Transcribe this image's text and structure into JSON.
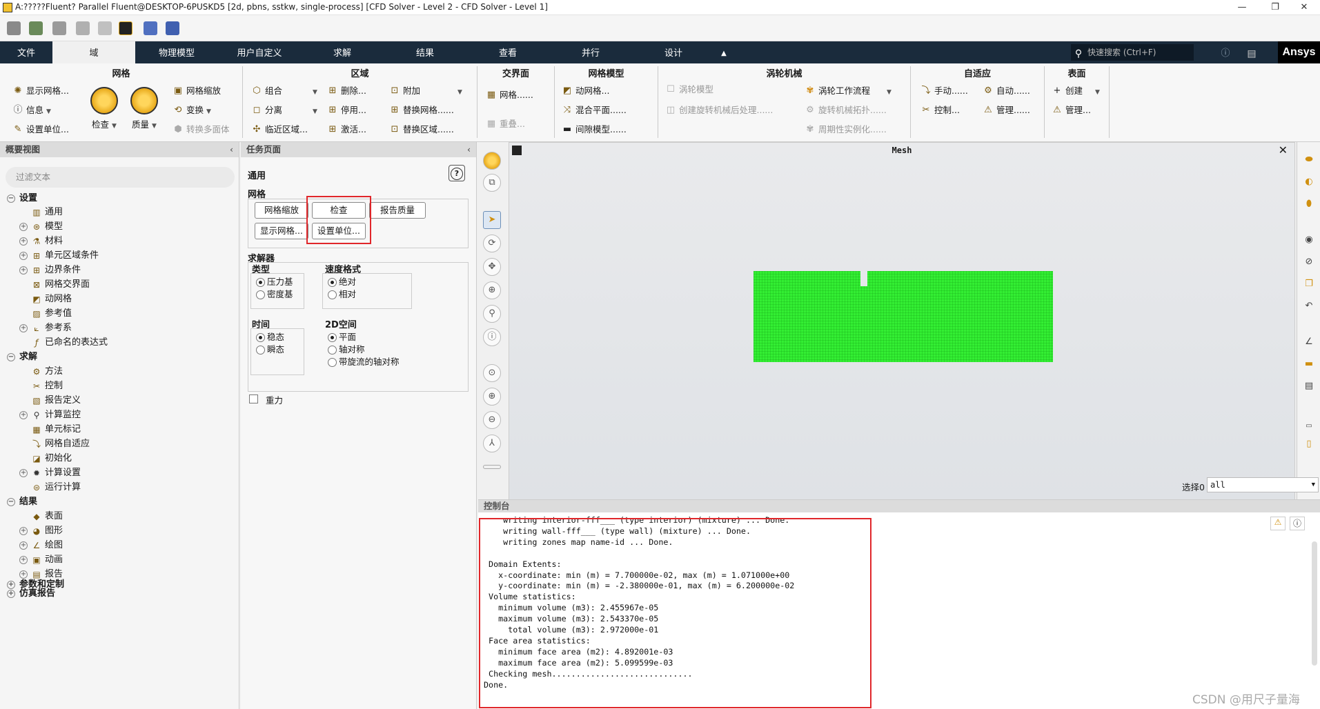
{
  "window": {
    "title": "A:?????Fluent? Parallel Fluent@DESKTOP-6PUSKD5  [2d, pbns, sstkw, single-process] [CFD Solver - Level 2 - CFD Solver - Level 1]",
    "minimize": "—",
    "restore": "❐",
    "close": "✕"
  },
  "tabs": [
    {
      "label": "文件"
    },
    {
      "label": "域"
    },
    {
      "label": "物理模型"
    },
    {
      "label": "用户自定义"
    },
    {
      "label": "求解"
    },
    {
      "label": "结果"
    },
    {
      "label": "查看"
    },
    {
      "label": "并行"
    },
    {
      "label": "设计"
    }
  ],
  "search": {
    "placeholder": "快速搜索 (Ctrl+F)"
  },
  "brand": "Ansys",
  "ribbon": {
    "mesh": {
      "title": "网格",
      "display": "显示网格...",
      "info": "信息",
      "units": "设置单位...",
      "check": "检查",
      "quality": "质量",
      "scale": "网格缩放",
      "transform": "变换",
      "polyhedra": "转换多面体"
    },
    "zones": {
      "title": "区域",
      "combine": "组合",
      "separate": "分离",
      "adjacency": "临近区域...",
      "delete": "删除...",
      "deactivate": "停用...",
      "activate": "激活...",
      "append": "附加",
      "replace_mesh": "替换网格......",
      "replace_zone": "替换区域......"
    },
    "interfaces": {
      "title": "交界面",
      "mesh": "网格......",
      "overset": "重叠..."
    },
    "mesh_models": {
      "title": "网格模型",
      "dynamic": "动网格...",
      "mixing_plane": "混合平面......",
      "gap_model": "间隙模型......"
    },
    "turbo": {
      "title": "涡轮机械",
      "turbo_model": "涡轮模型",
      "create_post": "创建旋转机械后处理......",
      "workflow": "涡轮工作流程",
      "topology": "旋转机械拓扑......",
      "periodic": "周期性实例化......"
    },
    "adapt": {
      "title": "自适应",
      "manual": "手动......",
      "control": "控制...",
      "auto": "自动......",
      "manage": "管理......"
    },
    "surface": {
      "title": "表面",
      "create": "创建",
      "manage": "管理..."
    }
  },
  "outline": {
    "title": "概要视图",
    "filter_placeholder": "过滤文本",
    "setup": {
      "label": "设置",
      "items": [
        "通用",
        "模型",
        "材料",
        "单元区域条件",
        "边界条件",
        "网格交界面",
        "动网格",
        "参考值",
        "参考系",
        "已命名的表达式"
      ]
    },
    "solution": {
      "label": "求解",
      "items": [
        "方法",
        "控制",
        "报告定义",
        "计算监控",
        "单元标记",
        "网格自适应",
        "初始化",
        "计算设置",
        "运行计算"
      ]
    },
    "results": {
      "label": "结果",
      "items": [
        "表面",
        "图形",
        "绘图",
        "动画",
        "报告"
      ]
    },
    "params": "参数和定制",
    "report": "仿真报告"
  },
  "task": {
    "title": "任务页面",
    "heading": "通用",
    "help": "?",
    "mesh_label": "网格",
    "btn_scale": "网格缩放",
    "btn_check": "检查",
    "btn_quality": "报告质量",
    "btn_display": "显示网格...",
    "btn_units": "设置单位...",
    "solver_label": "求解器",
    "type_label": "类型",
    "type_opts": [
      "压力基",
      "密度基"
    ],
    "velocity_label": "速度格式",
    "velocity_opts": [
      "绝对",
      "相对"
    ],
    "time_label": "时间",
    "time_opts": [
      "稳态",
      "瞬态"
    ],
    "space_label": "2D空间",
    "space_opts": [
      "平面",
      "轴对称",
      "带旋流的轴对称"
    ],
    "gravity": "重力"
  },
  "graphics": {
    "title": "Mesh",
    "close": "✕",
    "select_label": "选择0",
    "select_value": "all"
  },
  "console": {
    "title": "控制台",
    "lines": [
      "    writing interior-fff___ (type interior) (mixture) ... Done.",
      "    writing wall-fff___ (type wall) (mixture) ... Done.",
      "    writing zones map name-id ... Done.",
      "",
      " Domain Extents:",
      "   x-coordinate: min (m) = 7.700000e-02, max (m) = 1.071000e+00",
      "   y-coordinate: min (m) = -2.380000e-01, max (m) = 6.200000e-02",
      " Volume statistics:",
      "   minimum volume (m3): 2.455967e-05",
      "   maximum volume (m3): 2.543370e-05",
      "     total volume (m3): 2.972000e-01",
      " Face area statistics:",
      "   minimum face area (m2): 4.892001e-03",
      "   maximum face area (m2): 5.099599e-03",
      " Checking mesh.............................",
      "Done."
    ]
  },
  "watermark": "CSDN @用尺子量海",
  "colors": {
    "ribbon_bg": "#1a2b3c",
    "mesh": "#33ee33",
    "highlight": "#e0262a"
  }
}
